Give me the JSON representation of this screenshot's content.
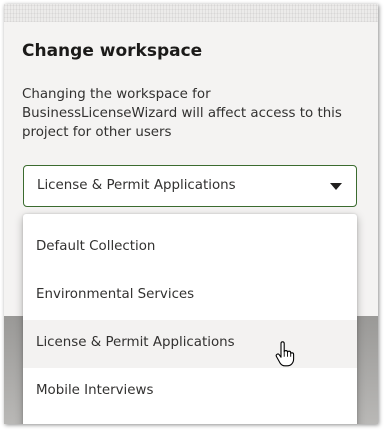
{
  "dialog": {
    "title": "Change workspace",
    "description": "Changing the workspace for BusinessLicenseWizard will affect access to this project for other users"
  },
  "select": {
    "selected": "License & Permit Applications",
    "border_color": "#3b6b2f"
  },
  "dropdown": {
    "options": [
      {
        "label": "Default Collection"
      },
      {
        "label": "Environmental Services"
      },
      {
        "label": "License & Permit Applications",
        "hovered": true
      },
      {
        "label": "Mobile Interviews"
      }
    ]
  },
  "cursor": {
    "icon": "hand-pointer-icon"
  }
}
